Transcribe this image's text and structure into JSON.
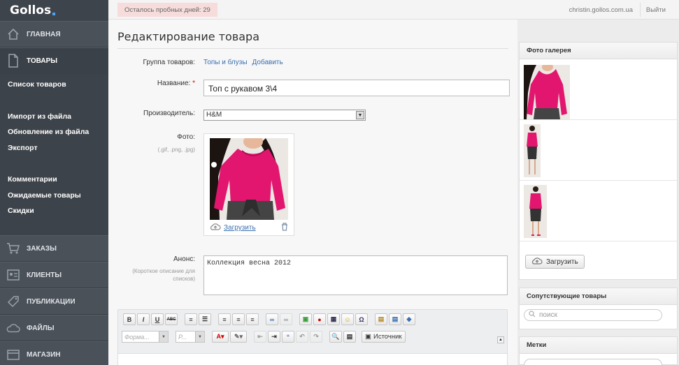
{
  "app": {
    "logo": "Gollos"
  },
  "sidebar": {
    "sections": [
      {
        "label": "ГЛАВНАЯ",
        "icon": "home-icon"
      },
      {
        "label": "ТОВАРЫ",
        "icon": "document-icon"
      }
    ],
    "products_sub": [
      "Список товаров",
      "Импорт из файла",
      "Обновление из файла",
      "Экспорт",
      "Комментарии",
      "Ожидаемые товары",
      "Скидки"
    ],
    "bottom_sections": [
      {
        "label": "ЗАКАЗЫ",
        "icon": "cart-icon"
      },
      {
        "label": "КЛИЕНТЫ",
        "icon": "contacts-icon"
      },
      {
        "label": "ПУБЛИКАЦИИ",
        "icon": "tag-icon"
      },
      {
        "label": "ФАЙЛЫ",
        "icon": "cloud-icon"
      },
      {
        "label": "МАГАЗИН",
        "icon": "shop-icon"
      }
    ]
  },
  "topbar": {
    "trial": "Осталось пробных дней: 29",
    "user": "christin.gollos.com.ua",
    "logout": "Выйти"
  },
  "form": {
    "title": "Редактирование товара",
    "group_label": "Группа товаров:",
    "group_value": "Топы и блузы",
    "group_add": "Добавить",
    "name_label": "Название:",
    "name_required": "*",
    "name_value": "Топ с рукавом 3\\4",
    "maker_label": "Производитель:",
    "maker_value": "H&M",
    "photo_label": "Фото:",
    "photo_hint": "(.gif, .png, .jpg)",
    "upload_link": "Загрузить",
    "announce_label": "Анонс:",
    "announce_hint": "(Короткое описание для списков)",
    "announce_value": "Коллекция весна 2012"
  },
  "editor": {
    "format_placeholder": "Форма...",
    "size_placeholder": "Р...",
    "source_label": "Источник",
    "row1": [
      "B",
      "I",
      "U",
      "ABC"
    ]
  },
  "right": {
    "gallery_title": "Фото галерея",
    "upload_button": "Загрузить",
    "related_title": "Сопутствующие товары",
    "search_placeholder": "поиск",
    "tags_title": "Метки"
  },
  "colors": {
    "accent_pink": "#e2166f",
    "sidebar": "#444a52",
    "link": "#3a6fb0"
  }
}
